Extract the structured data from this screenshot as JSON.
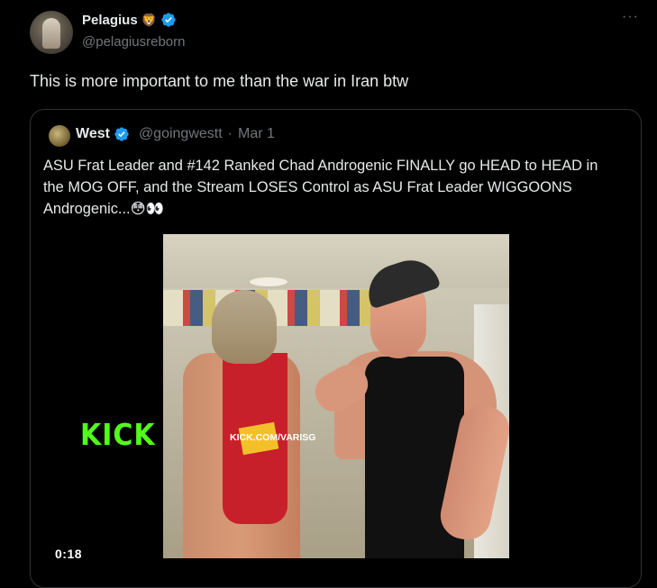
{
  "tweet": {
    "author": {
      "display_name": "Pelagius",
      "badge_emoji": "🦁",
      "handle": "@pelagiusreborn"
    },
    "more_label": "···",
    "text": "This is more important to me than the war in Iran btw"
  },
  "quote": {
    "author": {
      "display_name": "West",
      "handle": "@goingwestt",
      "separator": "·",
      "date": "Mar 1"
    },
    "text": "ASU Frat Leader and #142 Ranked Chad Androgenic FINALLY go HEAD to HEAD in the MOG OFF, and the Stream LOSES Control as ASU Frat Leader WIGGOONS Androgenic...😳👀",
    "video": {
      "duration": "0:18",
      "watermark_logo": "KICK",
      "watermark_url": "KICK.COM/VARISG"
    }
  },
  "colors": {
    "background": "#000000",
    "primary_text": "#e7e9ea",
    "secondary_text": "#71767b",
    "border": "#2f3336",
    "verified": "#1d9bf0",
    "kick_green": "#53fc18"
  }
}
